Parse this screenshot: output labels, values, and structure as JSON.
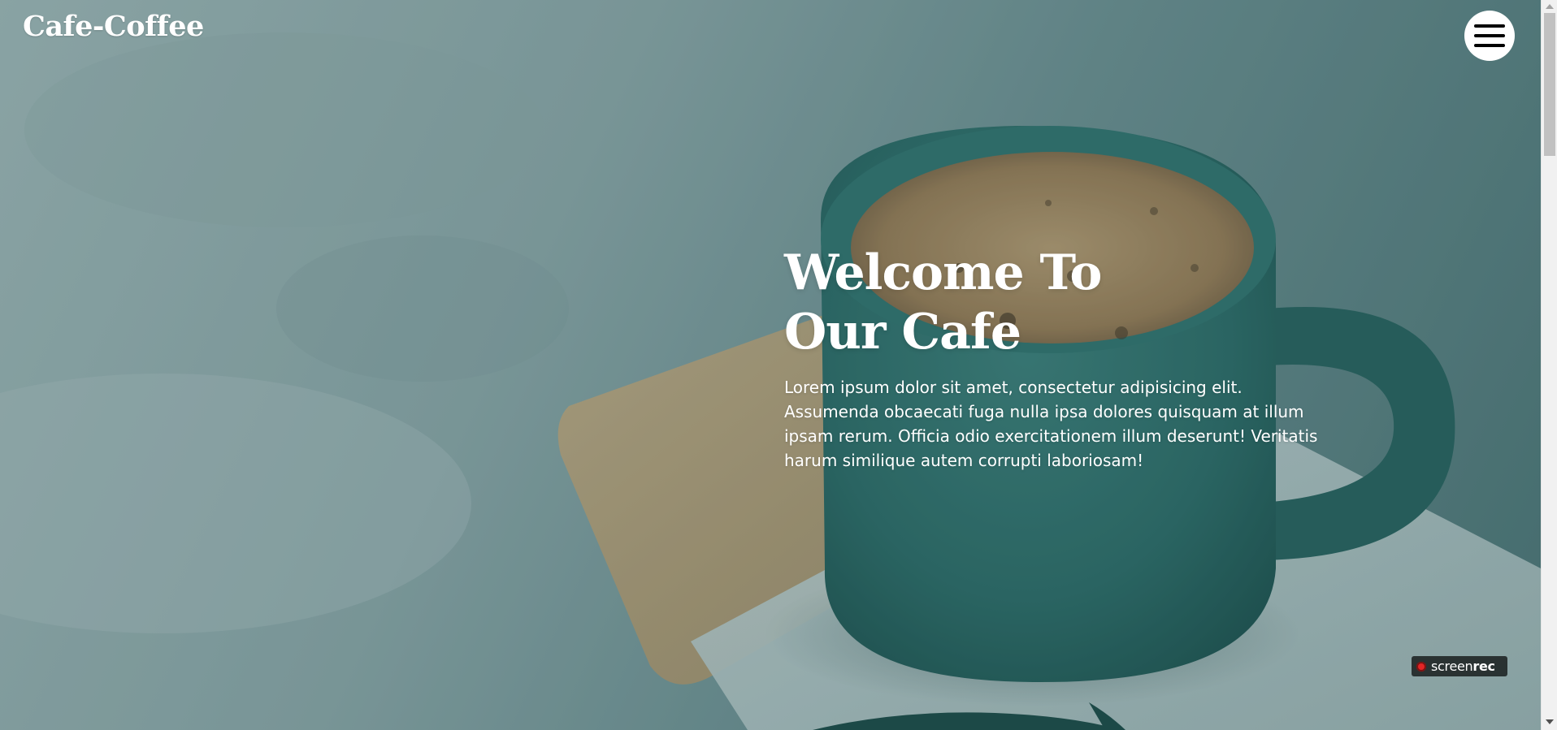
{
  "header": {
    "logo": "Cafe-Coffee",
    "menu_icon": "hamburger-menu-icon"
  },
  "hero": {
    "title_line1": "Welcome To",
    "title_line2": "Our Cafe",
    "text": "Lorem ipsum dolor sit amet, consectetur adipisicing elit. Assumenda obcaecati fuga nulla ipsa dolores quisquam at illum ipsam rerum. Officia odio exercitationem illum deserunt! Veritatis harum similique autem corrupti laboriosam!"
  },
  "overlay_badge": {
    "label_part1": "screen",
    "label_part2": "rec",
    "icon": "record-dot-icon"
  },
  "colors": {
    "text": "#ffffff",
    "menu_button_bg": "#ffffff",
    "mug": "#2f6b68",
    "record_dot": "#e22525"
  }
}
